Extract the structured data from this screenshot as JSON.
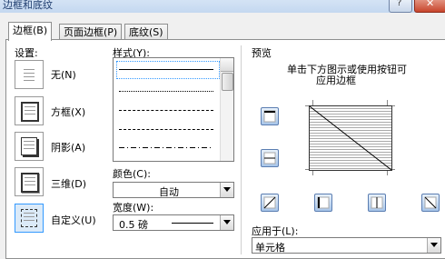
{
  "window": {
    "title": "边框和底纹",
    "help_glyph": "?",
    "close_glyph": "✕"
  },
  "tabs": [
    {
      "label": "边框(B)",
      "active": true
    },
    {
      "label": "页面边框(P)",
      "active": false
    },
    {
      "label": "底纹(S)",
      "active": false
    }
  ],
  "settings": {
    "heading": "设置:",
    "items": [
      {
        "label": "无(N)",
        "icon": "no-border-icon"
      },
      {
        "label": "方框(X)",
        "icon": "box-border-icon"
      },
      {
        "label": "阴影(A)",
        "icon": "shadow-border-icon"
      },
      {
        "label": "三维(D)",
        "icon": "3d-border-icon"
      },
      {
        "label": "自定义(U)",
        "icon": "custom-border-icon",
        "selected": true
      }
    ]
  },
  "style": {
    "heading": "样式(Y):",
    "options": [
      "solid",
      "dotted",
      "dashed",
      "dashed",
      "dash-dot"
    ],
    "selected_index": 0
  },
  "color": {
    "label": "颜色(C):",
    "value": "自动"
  },
  "width": {
    "label": "宽度(W):",
    "value": "0.5 磅"
  },
  "preview": {
    "heading": "预览",
    "hint_line1": "单击下方图示或使用按钮可",
    "hint_line2": "应用边框"
  },
  "apply_to": {
    "label": "应用于(L):",
    "value": "单元格"
  },
  "colors": {
    "accent": "#3399ff",
    "selected_bg": "#dbeaf8"
  }
}
